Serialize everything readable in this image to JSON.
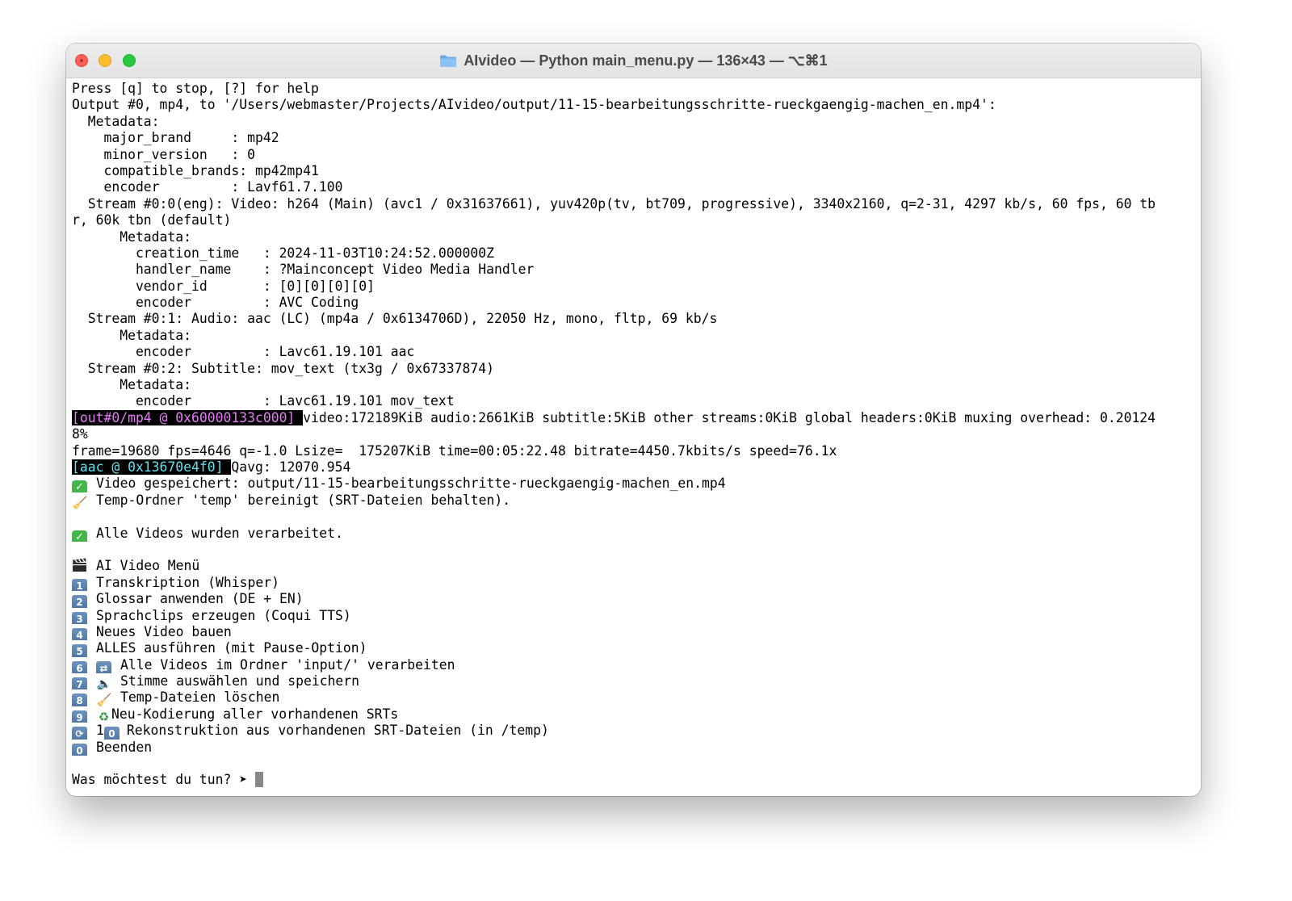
{
  "window": {
    "title": "AIvideo — Python main_menu.py — 136×43 — ⌥⌘1"
  },
  "colors": {
    "tag_magenta": "#e67cf5",
    "tag_cyan": "#5fe3f0",
    "check_green": "#43b649",
    "keycap_blue": "#5b84b3"
  },
  "terminal": {
    "l1": "Press [q] to stop, [?] for help",
    "l2": "Output #0, mp4, to '/Users/webmaster/Projects/AIvideo/output/11-15-bearbeitungsschritte-rueckgaengig-machen_en.mp4':",
    "l3": "  Metadata:",
    "l4": "    major_brand     : mp42",
    "l5": "    minor_version   : 0",
    "l6": "    compatible_brands: mp42mp41",
    "l7": "    encoder         : Lavf61.7.100",
    "l8": "  Stream #0:0(eng): Video: h264 (Main) (avc1 / 0x31637661), yuv420p(tv, bt709, progressive), 3340x2160, q=2-31, 4297 kb/s, 60 fps, 60 tb",
    "l9": "r, 60k tbn (default)",
    "l10": "      Metadata:",
    "l11": "        creation_time   : 2024-11-03T10:24:52.000000Z",
    "l12": "        handler_name    : ?Mainconcept Video Media Handler",
    "l13": "        vendor_id       : [0][0][0][0]",
    "l14": "        encoder         : AVC Coding",
    "l15": "  Stream #0:1: Audio: aac (LC) (mp4a / 0x6134706D), 22050 Hz, mono, fltp, 69 kb/s",
    "l16": "      Metadata:",
    "l17": "        encoder         : Lavc61.19.101 aac",
    "l18": "  Stream #0:2: Subtitle: mov_text (tx3g / 0x67337874)",
    "l19": "      Metadata:",
    "l20": "        encoder         : Lavc61.19.101 mov_text",
    "l21_tag": "[out#0/mp4 @ 0x60000133c000] ",
    "l21_text": "video:172189KiB audio:2661KiB subtitle:5KiB other streams:0KiB global headers:0KiB muxing overhead: 0.20124",
    "l22": "8%",
    "l23": "frame=19680 fps=4646 q=-1.0 Lsize=  175207KiB time=00:05:22.48 bitrate=4450.7kbits/s speed=76.1x",
    "l24_tag": "[aac @ 0x13670e4f0] ",
    "l24_text": "Qavg: 12070.954",
    "l25": "Video gespeichert: output/11-15-bearbeitungsschritte-rueckgaengig-machen_en.mp4",
    "l26": "Temp-Ordner 'temp' bereinigt (SRT-Dateien behalten).",
    "l28": "Alle Videos wurden verarbeitet.",
    "menu_title": "AI Video Menü",
    "menu": [
      {
        "key": "1",
        "label": "Transkription (Whisper)"
      },
      {
        "key": "2",
        "label": "Glossar anwenden (DE + EN)"
      },
      {
        "key": "3",
        "label": "Sprachclips erzeugen (Coqui TTS)"
      },
      {
        "key": "4",
        "label": "Neues Video bauen"
      },
      {
        "key": "5",
        "label": "ALLES ausführen (mit Pause-Option)"
      },
      {
        "key": "6",
        "icon": "🔁",
        "label": "Alle Videos im Ordner 'input/' verarbeiten"
      },
      {
        "key": "7",
        "icon": "🔈",
        "label": "Stimme auswählen und speichern"
      },
      {
        "key": "8",
        "icon": "🧹",
        "label": "Temp-Dateien löschen"
      },
      {
        "key": "9",
        "icon": "♻️",
        "label": "Neu-Kodierung aller vorhandenen SRTs"
      },
      {
        "key": "🔄",
        "prefix": "1",
        "key2": "0",
        "label": "Rekonstruktion aus vorhandenen SRT-Dateien (in /temp)"
      },
      {
        "key": "0",
        "label": "Beenden"
      }
    ],
    "prompt": "Was möchtest du tun? ➤ "
  }
}
